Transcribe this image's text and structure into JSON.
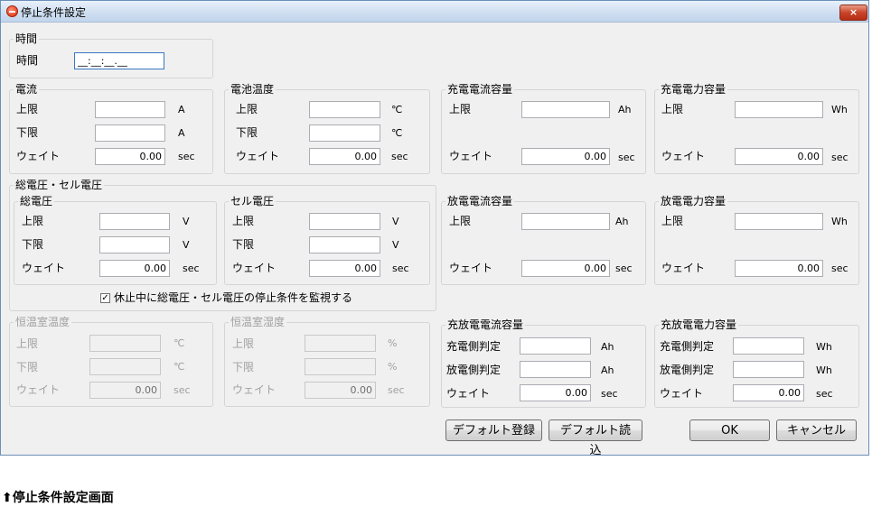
{
  "window": {
    "title": "停止条件設定",
    "close_label": "×"
  },
  "time": {
    "legend": "時間",
    "label": "時間",
    "value": "__:__:__.__"
  },
  "current": {
    "legend": "電流",
    "upper": "上限",
    "lower": "下限",
    "wait": "ウェイト",
    "unit": "A",
    "wait_unit": "sec",
    "upper_value": "",
    "lower_value": "",
    "wait_value": "0.00"
  },
  "battery_temp": {
    "legend": "電池温度",
    "upper": "上限",
    "lower": "下限",
    "wait": "ウェイト",
    "unit": "℃",
    "wait_unit": "sec",
    "upper_value": "",
    "lower_value": "",
    "wait_value": "0.00"
  },
  "charge_current_capacity": {
    "legend": "充電電流容量",
    "upper": "上限",
    "wait": "ウェイト",
    "unit": "Ah",
    "wait_unit": "sec",
    "upper_value": "",
    "wait_value": "0.00"
  },
  "charge_power_capacity": {
    "legend": "充電電力容量",
    "upper": "上限",
    "wait": "ウェイト",
    "unit": "Wh",
    "wait_unit": "sec",
    "upper_value": "",
    "wait_value": "0.00"
  },
  "voltage_group": {
    "legend": "総電圧・セル電圧",
    "monitor_label": "休止中に総電圧・セル電圧の停止条件を監視する",
    "monitor_checked": "✓"
  },
  "total_voltage": {
    "legend": "総電圧",
    "upper": "上限",
    "lower": "下限",
    "wait": "ウェイト",
    "unit": "V",
    "wait_unit": "sec",
    "upper_value": "",
    "lower_value": "",
    "wait_value": "0.00"
  },
  "cell_voltage": {
    "legend": "セル電圧",
    "upper": "上限",
    "lower": "下限",
    "wait": "ウェイト",
    "unit": "V",
    "wait_unit": "sec",
    "upper_value": "",
    "lower_value": "",
    "wait_value": "0.00"
  },
  "discharge_current_capacity": {
    "legend": "放電電流容量",
    "upper": "上限",
    "wait": "ウェイト",
    "unit": "Ah",
    "wait_unit": "sec",
    "upper_value": "",
    "wait_value": "0.00"
  },
  "discharge_power_capacity": {
    "legend": "放電電力容量",
    "upper": "上限",
    "wait": "ウェイト",
    "unit": "Wh",
    "wait_unit": "sec",
    "upper_value": "",
    "wait_value": "0.00"
  },
  "chamber_temp": {
    "legend": "恒温室温度",
    "upper": "上限",
    "lower": "下限",
    "wait": "ウェイト",
    "unit": "℃",
    "wait_unit": "sec",
    "upper_value": "",
    "lower_value": "",
    "wait_value": "0.00"
  },
  "chamber_humidity": {
    "legend": "恒温室湿度",
    "upper": "上限",
    "lower": "下限",
    "wait": "ウェイト",
    "unit": "%",
    "wait_unit": "sec",
    "upper_value": "",
    "lower_value": "",
    "wait_value": "0.00"
  },
  "charge_discharge_current_capacity": {
    "legend": "充放電電流容量",
    "charge_side": "充電側判定",
    "discharge_side": "放電側判定",
    "wait": "ウェイト",
    "unit": "Ah",
    "wait_unit": "sec",
    "charge_value": "",
    "discharge_value": "",
    "wait_value": "0.00"
  },
  "charge_discharge_power_capacity": {
    "legend": "充放電電力容量",
    "charge_side": "充電側判定",
    "discharge_side": "放電側判定",
    "wait": "ウェイト",
    "unit": "Wh",
    "wait_unit": "sec",
    "charge_value": "",
    "discharge_value": "",
    "wait_value": "0.00"
  },
  "buttons": {
    "default_register": "デフォルト登録",
    "default_load": "デフォルト読込",
    "ok": "OK",
    "cancel": "キャンセル"
  },
  "caption": "⬆停止条件設定画面"
}
